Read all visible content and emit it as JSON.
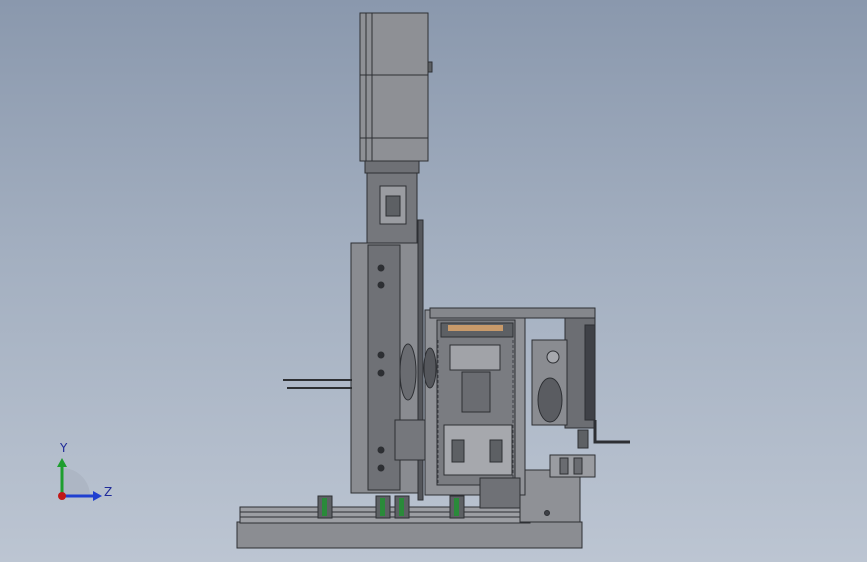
{
  "viewport": {
    "background_top": "#8a98ad",
    "background_bottom": "#bcc5d2"
  },
  "triad": {
    "y_label": "Y",
    "z_label": "Z",
    "y_color": "#1e9e2e",
    "z_color": "#1f3fd0",
    "x_color": "#c01818"
  },
  "model": {
    "body_color": "#7d7f85",
    "dark_color": "#3f4147",
    "light_color": "#a9abb0",
    "rail_accent": "#2a8a3a",
    "clamp_accent": "#c89a6a"
  }
}
